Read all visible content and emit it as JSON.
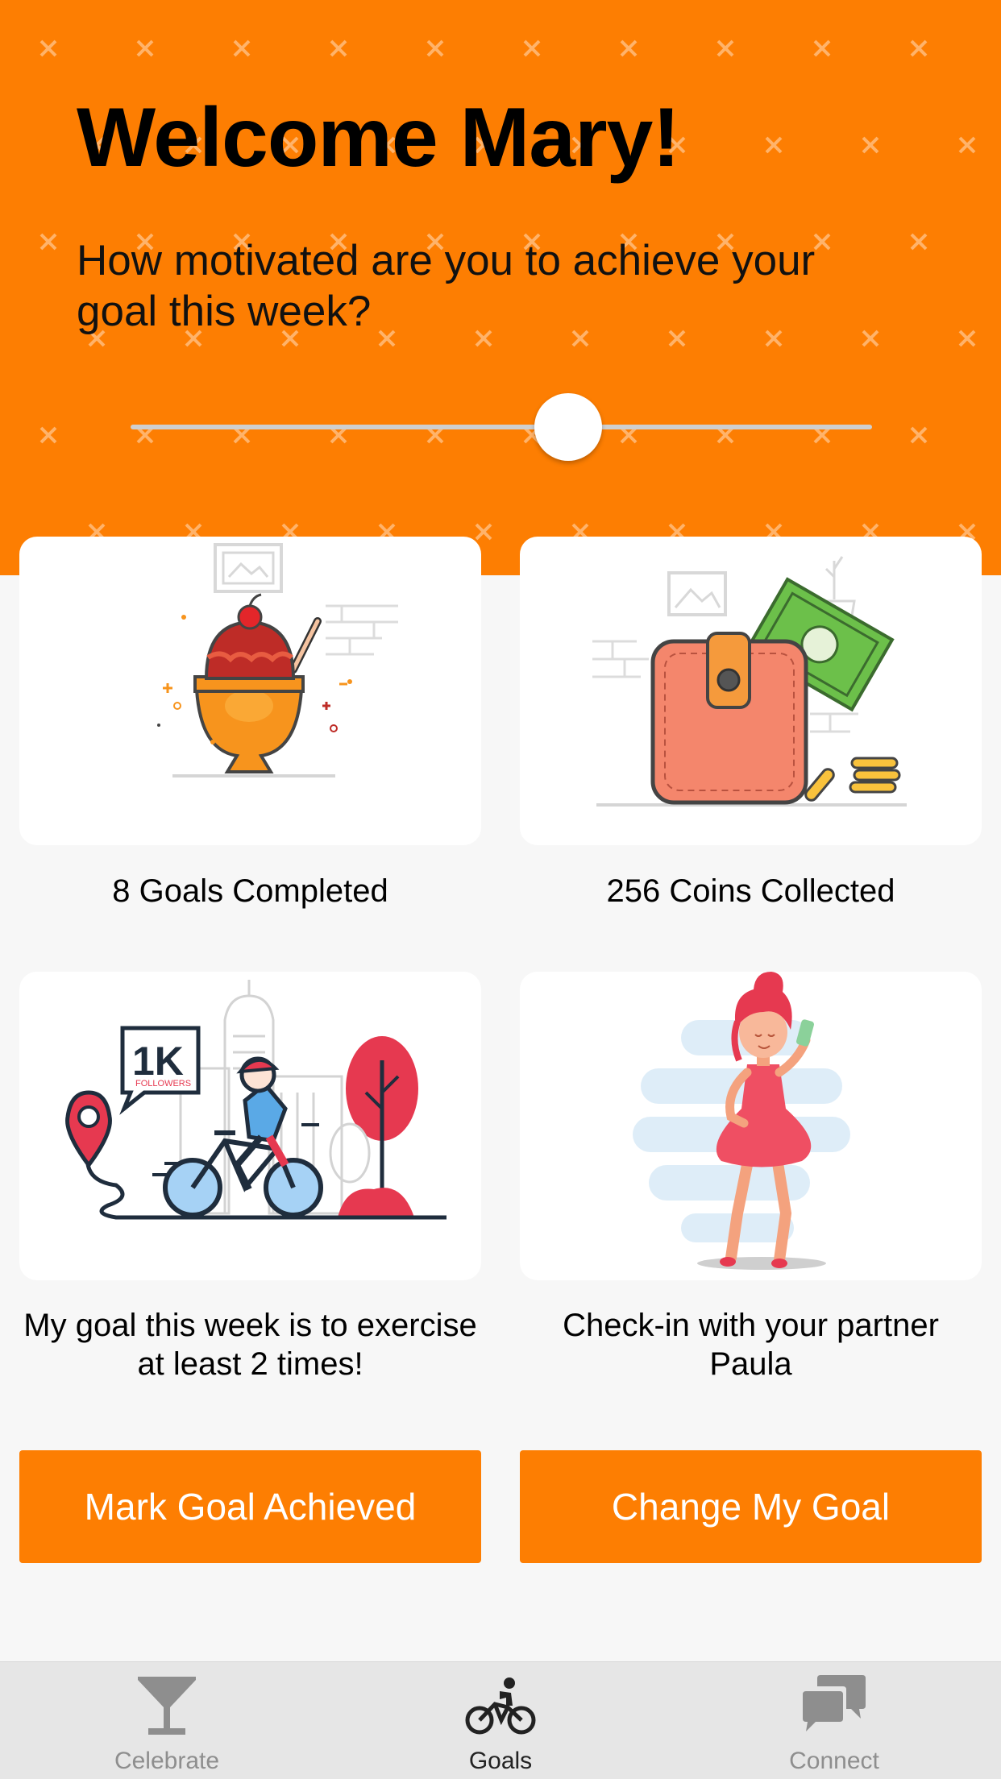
{
  "header": {
    "title": "Welcome Mary!",
    "question": "How motivated are you to achieve your goal this week?",
    "background_color": "#fd7e02",
    "pattern_icon": "x-pattern"
  },
  "motivation_slider": {
    "value_fraction": 0.59
  },
  "cards": [
    {
      "caption": "8 Goals Completed",
      "illustration": "ice-cream-sundae-illustration"
    },
    {
      "caption": "256 Coins Collected",
      "illustration": "wallet-coins-illustration"
    },
    {
      "caption": "My goal this week is to exercise at least 2 times!",
      "illustration": "cyclist-illustration",
      "badge_text": "1K",
      "badge_subtext": "FOLLOWERS"
    },
    {
      "caption": "Check-in with your partner Paula",
      "illustration": "partner-woman-illustration"
    }
  ],
  "buttons": {
    "mark_goal": "Mark Goal Achieved",
    "change_goal": "Change My Goal",
    "color": "#fd7e02"
  },
  "tabbar": {
    "tabs": [
      {
        "label": "Celebrate",
        "icon": "cocktail-glass-icon",
        "active": false
      },
      {
        "label": "Goals",
        "icon": "bicycle-icon",
        "active": true
      },
      {
        "label": "Connect",
        "icon": "chat-bubbles-icon",
        "active": false
      }
    ]
  }
}
